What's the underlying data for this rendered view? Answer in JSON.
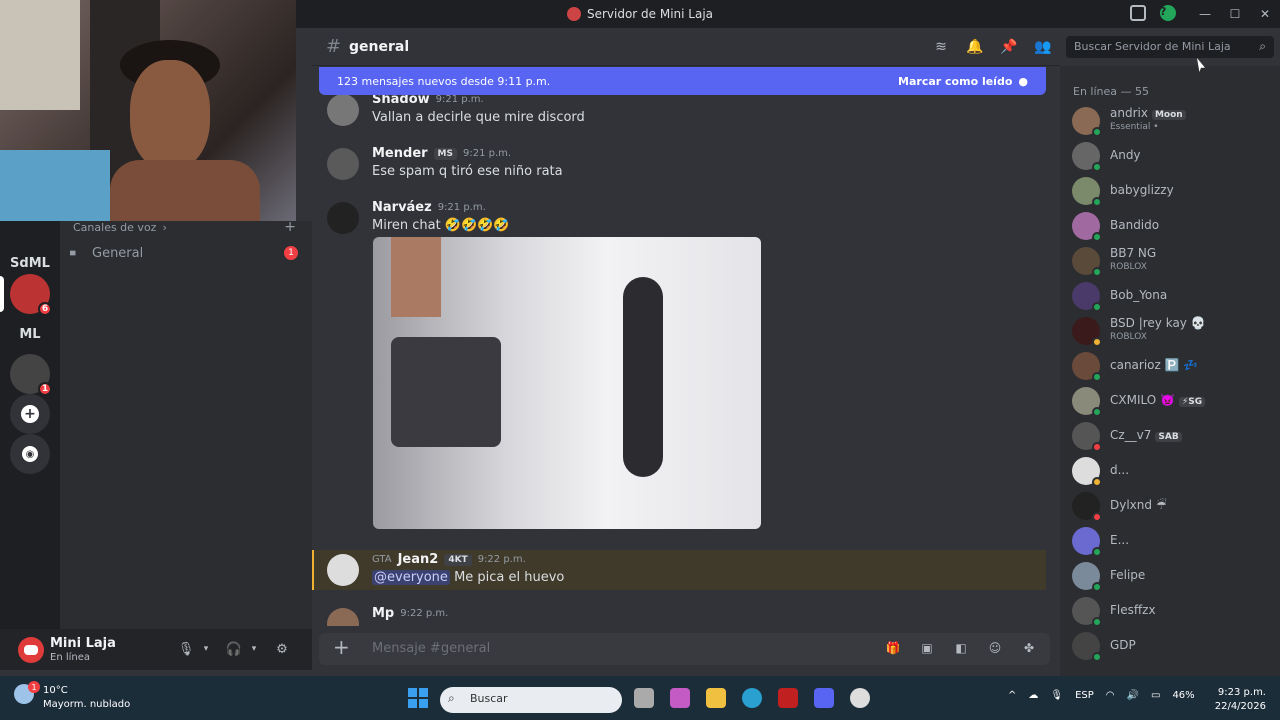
{
  "window": {
    "title": "Servidor de Mini Laja"
  },
  "guilds": [
    {
      "label": "SdML"
    },
    {
      "label": "",
      "badge": "6"
    },
    {
      "label": "ML"
    },
    {
      "label": "",
      "badge": "1"
    }
  ],
  "channels": {
    "category": "Canales de voz",
    "category_chevron": "›",
    "add": "+",
    "items": [
      {
        "name": "General",
        "unread": "1"
      }
    ]
  },
  "user": {
    "name": "Mini Laja",
    "status": "En línea"
  },
  "chat": {
    "channel": "general",
    "new_messages": "123 mensajes nuevos desde 9:11 p.m.",
    "mark_read": "Marcar como leído",
    "messages": [
      {
        "author": "Shadow",
        "time": "9:21 p.m.",
        "text": "Vallan a decirle que mire discord"
      },
      {
        "author": "Mender",
        "tag": "MS",
        "time": "9:21 p.m.",
        "text": "Ese spam q tiró ese niño rata"
      },
      {
        "author": "Narváez",
        "time": "9:21 p.m.",
        "text": "Miren chat 🤣🤣🤣🤣"
      },
      {
        "author": "Jean2",
        "prefix": "GTA",
        "tag": "4KT",
        "time": "9:22 p.m.",
        "mention": "@everyone",
        "text": "Me pica el huevo"
      },
      {
        "author": "Mp",
        "time": "9:22 p.m."
      }
    ],
    "input_placeholder": "Mensaje #general"
  },
  "search": {
    "placeholder": "Buscar Servidor de Mini Laja"
  },
  "members": {
    "heading": "En línea — 55",
    "list": [
      {
        "name": "andrix",
        "tag": "Moon",
        "sub": "Essential •"
      },
      {
        "name": "Andy"
      },
      {
        "name": "babyglizzy"
      },
      {
        "name": "Bandido"
      },
      {
        "name": "BB7 NG",
        "sub": "ROBLOX"
      },
      {
        "name": "Bob_Yona"
      },
      {
        "name": "BSD |rey kay 💀",
        "sub": "ROBLOX"
      },
      {
        "name": "canarioz 🅿️ 💤"
      },
      {
        "name": "CXMILO 👿",
        "tag": "⚡SG"
      },
      {
        "name": "Cz__v7",
        "tag": "SAB"
      },
      {
        "name": "d..."
      },
      {
        "name": "Dylxnd ☔"
      },
      {
        "name": "E..."
      },
      {
        "name": "Felipe"
      },
      {
        "name": "Flesffzx"
      },
      {
        "name": "GDP"
      }
    ]
  },
  "taskbar": {
    "temp": "10°C",
    "weather": "Mayorm. nublado",
    "search": "Buscar",
    "lang": "ESP",
    "battery": "46%",
    "time": "9:23 p.m.",
    "date": "22/4/2026",
    "weather_badge": "1"
  }
}
